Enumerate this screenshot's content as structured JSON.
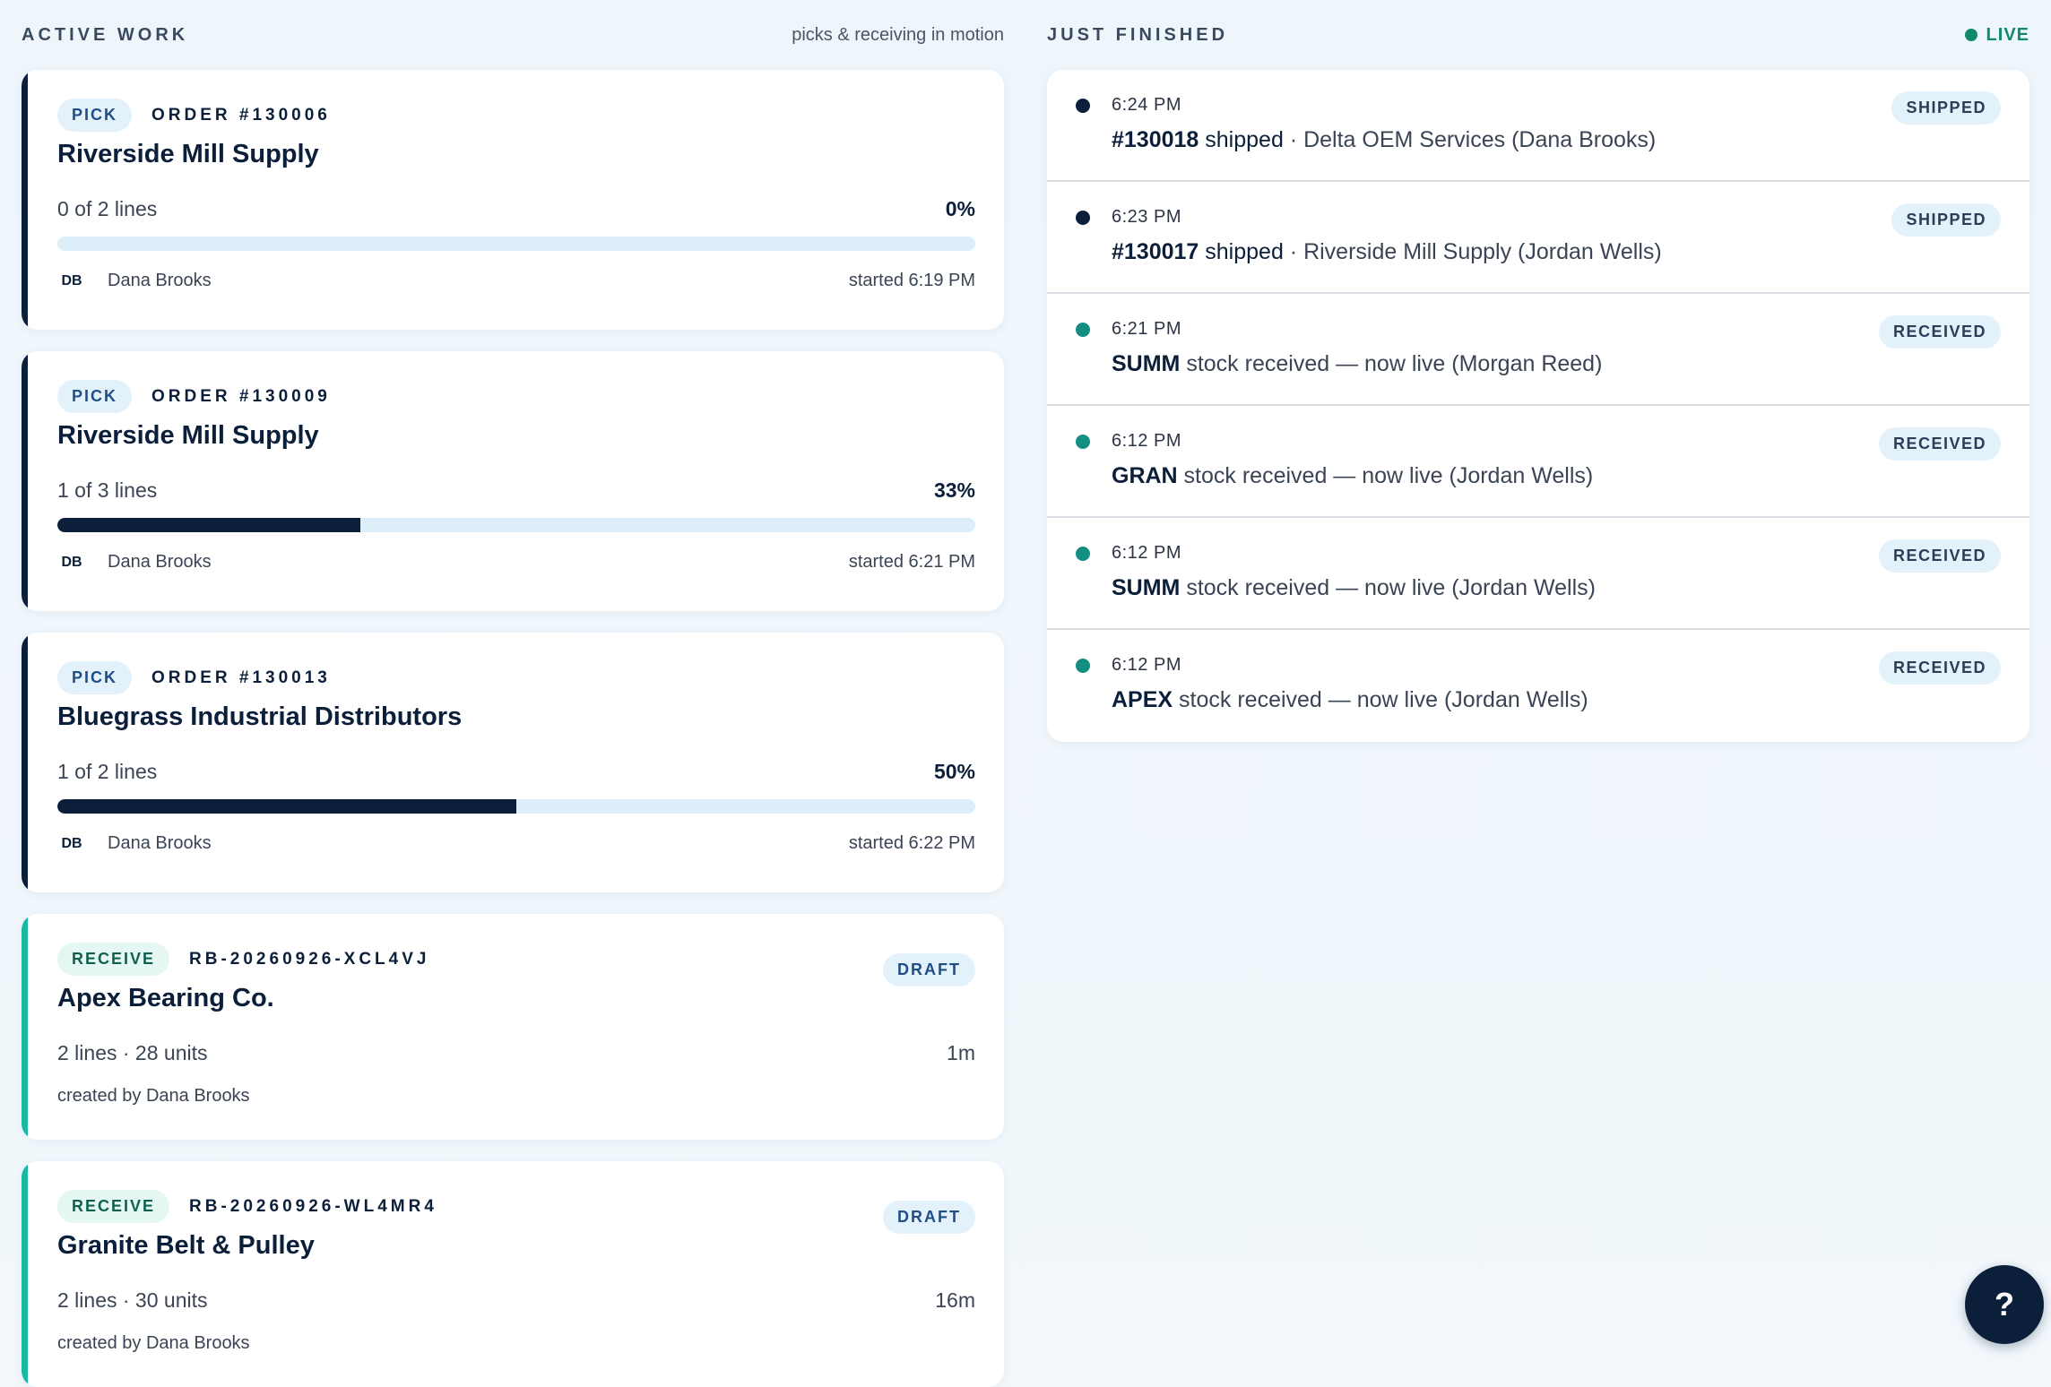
{
  "active": {
    "title": "ACTIVE WORK",
    "subtitle": "picks & receiving in motion",
    "picks": [
      {
        "tag": "PICK",
        "order": "ORDER #130006",
        "customer": "Riverside Mill Supply",
        "lines": "0 of 2 lines",
        "pct": "0%",
        "progress": 0,
        "avatar": "DB",
        "user": "Dana Brooks",
        "started": "started 6:19 PM"
      },
      {
        "tag": "PICK",
        "order": "ORDER #130009",
        "customer": "Riverside Mill Supply",
        "lines": "1 of 3 lines",
        "pct": "33%",
        "progress": 33,
        "avatar": "DB",
        "user": "Dana Brooks",
        "started": "started 6:21 PM"
      },
      {
        "tag": "PICK",
        "order": "ORDER #130013",
        "customer": "Bluegrass Industrial Distributors",
        "lines": "1 of 2 lines",
        "pct": "50%",
        "progress": 50,
        "avatar": "DB",
        "user": "Dana Brooks",
        "started": "started 6:22 PM"
      }
    ],
    "receives": [
      {
        "tag": "RECEIVE",
        "id": "RB-20260926-XCL4VJ",
        "supplier": "Apex Bearing Co.",
        "status": "DRAFT",
        "summary": "2 lines · 28 units",
        "age": "1m",
        "created": "created by Dana Brooks"
      },
      {
        "tag": "RECEIVE",
        "id": "RB-20260926-WL4MR4",
        "supplier": "Granite Belt & Pulley",
        "status": "DRAFT",
        "summary": "2 lines · 30 units",
        "age": "16m",
        "created": "created by Dana Brooks"
      }
    ]
  },
  "finished": {
    "title": "JUST FINISHED",
    "live": "LIVE",
    "items": [
      {
        "time": "6:24 PM",
        "strong": "#130018",
        "text": " shipped",
        "rest": " · Delta OEM Services (Dana Brooks)",
        "badge": "SHIPPED",
        "kind": "ship"
      },
      {
        "time": "6:23 PM",
        "strong": "#130017",
        "text": " shipped",
        "rest": " · Riverside Mill Supply (Jordan Wells)",
        "badge": "SHIPPED",
        "kind": "ship"
      },
      {
        "time": "6:21 PM",
        "strong": "SUMM",
        "text": " stock received — now live (Morgan Reed)",
        "rest": "",
        "badge": "RECEIVED",
        "kind": "recv"
      },
      {
        "time": "6:12 PM",
        "strong": "GRAN",
        "text": " stock received — now live (Jordan Wells)",
        "rest": "",
        "badge": "RECEIVED",
        "kind": "recv"
      },
      {
        "time": "6:12 PM",
        "strong": "SUMM",
        "text": " stock received — now live (Jordan Wells)",
        "rest": "",
        "badge": "RECEIVED",
        "kind": "recv"
      },
      {
        "time": "6:12 PM",
        "strong": "APEX",
        "text": " stock received — now live (Jordan Wells)",
        "rest": "",
        "badge": "RECEIVED",
        "kind": "recv"
      }
    ]
  },
  "help": {
    "label": "?"
  }
}
